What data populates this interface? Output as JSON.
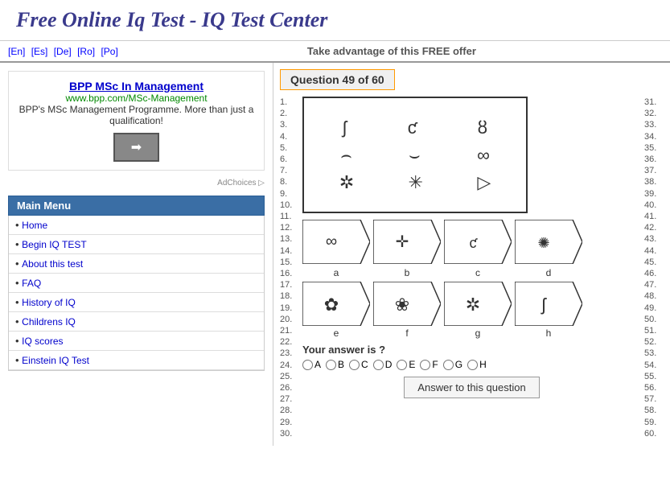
{
  "header": {
    "title": "Free Online Iq Test - IQ Test Center"
  },
  "langBar": {
    "langs": [
      "[En]",
      "[Es]",
      "[De]",
      "[Ro]",
      "[Po]"
    ],
    "offer": "Take advantage of this FREE offer"
  },
  "ad": {
    "title": "BPP MSc In Management",
    "url": "www.bpp.com/MSc-Management",
    "desc": "BPP's MSc Management Programme. More than just a qualification!",
    "choices": "AdChoices ▷"
  },
  "menu": {
    "header": "Main Menu",
    "items": [
      {
        "label": "Home",
        "href": "#"
      },
      {
        "label": "Begin IQ TEST",
        "href": "#"
      },
      {
        "label": "About this test",
        "href": "#"
      },
      {
        "label": "FAQ",
        "href": "#"
      },
      {
        "label": "History of IQ",
        "href": "#"
      },
      {
        "label": "Childrens IQ",
        "href": "#"
      },
      {
        "label": "IQ scores",
        "href": "#"
      },
      {
        "label": "Einstein IQ Test",
        "href": "#"
      }
    ]
  },
  "question": {
    "label": "Question 49 of 60",
    "leftNums": [
      "1.",
      "2.",
      "3.",
      "4.",
      "5.",
      "6.",
      "7.",
      "8.",
      "9.",
      "10.",
      "11.",
      "12.",
      "13.",
      "14.",
      "15.",
      "16.",
      "17.",
      "18.",
      "19.",
      "20.",
      "21.",
      "22.",
      "23.",
      "24.",
      "25.",
      "26.",
      "27.",
      "28.",
      "29.",
      "30."
    ],
    "rightNums": [
      "31.",
      "32.",
      "33.",
      "34.",
      "35.",
      "36.",
      "37.",
      "38.",
      "39.",
      "40.",
      "41.",
      "42.",
      "43.",
      "44.",
      "45.",
      "46.",
      "47.",
      "48.",
      "49.",
      "50.",
      "51.",
      "52.",
      "53.",
      "54.",
      "55.",
      "56.",
      "57.",
      "58.",
      "59.",
      "60."
    ],
    "choiceLabels": [
      "a",
      "b",
      "c",
      "d",
      "e",
      "f",
      "g",
      "h"
    ],
    "answerLabel": "Your answer is ?",
    "radioOptions": [
      "A",
      "B",
      "C",
      "D",
      "E",
      "F",
      "G",
      "H"
    ],
    "answerButton": "Answer to this question"
  }
}
